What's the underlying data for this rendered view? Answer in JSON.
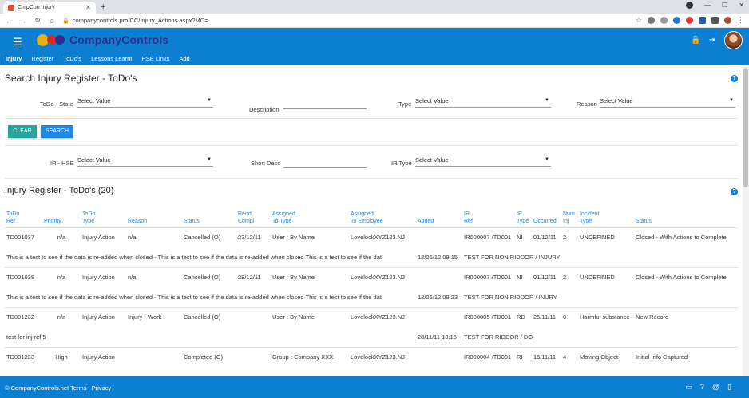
{
  "browser": {
    "tab_title": "CmpCon Injury",
    "url": "companycontrols.pro/CC/Injury_Actions.aspx?MC="
  },
  "app": {
    "brand": "CompanyControls",
    "nav": [
      "Injury",
      "Register",
      "ToDo's",
      "Lessons Learnt",
      "HSE Links",
      "Add"
    ]
  },
  "search": {
    "title": "Search  Injury Register - ToDo's",
    "todo_state_label": "ToDo - State",
    "todo_state_value": "Select Value",
    "description_label": "Description",
    "type_label": "Type",
    "type_value": "Select Value",
    "reason_label": "Reason",
    "reason_value": "Select Value",
    "clear_label": "CLEAR",
    "search_label": "SEARCH",
    "ir_hse_label": "IR - HSE",
    "ir_hse_value": "Select Value",
    "short_desc_label": "Short Desc",
    "ir_type_label": "IR Type",
    "ir_type_value": "Select Value"
  },
  "register": {
    "title": "Injury Register - ToDo's (20)",
    "headers": {
      "todo_ref": [
        "ToDo",
        "Ref"
      ],
      "priority": [
        "",
        "Priority"
      ],
      "todo_type": [
        "ToDo",
        "Type"
      ],
      "reason": [
        "",
        "Reason"
      ],
      "status": [
        "",
        "Status"
      ],
      "reqd_compl": [
        "Reqd",
        "Compl"
      ],
      "assigned_type": [
        "Assigned",
        "To Type"
      ],
      "assigned_emp": [
        "Assigned",
        "To Employee"
      ],
      "added": [
        "",
        "Added"
      ],
      "ir_ref": [
        "IR",
        "Ref"
      ],
      "ir_type": [
        "IR",
        "Type"
      ],
      "occurred": [
        "",
        "Occurred"
      ],
      "num_inj": [
        "Num",
        "Inj"
      ],
      "incident_type": [
        "Incident",
        "Type"
      ],
      "ir_status": [
        "",
        "Status"
      ]
    },
    "rows": [
      {
        "ref": "TD001037",
        "priority": "n/a",
        "type": "Injury Action",
        "reason": "n/a",
        "status": "Cancelled (O)",
        "reqd": "23/12/11",
        "assign_type": "User : By Name",
        "assign_emp": "LovelockXYZ123.NJ",
        "ir_ref": "IR000007 /TD001",
        "ir_type": "NI",
        "occurred": "01/12/11",
        "num_inj": "2",
        "incident": "UNDEFINED",
        "ir_status": "Closed - With Actions to Complete",
        "desc": "This is a test to see if the data is re-added when closed - This is a test to see if the data is re-added when closed This is a test to see if the dat",
        "added": "12/06/12 09:15",
        "short_desc": "TEST FOR NON RIDDOR / INJURY"
      },
      {
        "ref": "TD001038",
        "priority": "n/a",
        "type": "Injury Action",
        "reason": "n/a",
        "status": "Cancelled (O)",
        "reqd": "28/12/11",
        "assign_type": "User : By Name",
        "assign_emp": "LovelockXYZ123.NJ",
        "ir_ref": "IR000007 /TD001",
        "ir_type": "NI",
        "occurred": "01/12/11",
        "num_inj": "2",
        "incident": "UNDEFINED",
        "ir_status": "Closed - With Actions to Complete",
        "desc": "This is a test to see if the data is re-added when closed - This is a test to see if the data is re-added when closed This is a test to see if the dat",
        "added": "12/06/12 09:23",
        "short_desc": "TEST FOR NON RIDDOR / INURY"
      },
      {
        "ref": "TD001232",
        "priority": "n/a",
        "type": "Injury Action",
        "reason": "Injury - Work",
        "status": "Cancelled (O)",
        "reqd": "",
        "assign_type": "User : By Name",
        "assign_emp": "LovelockXYZ123.NJ",
        "ir_ref": "IR000005 /TD001",
        "ir_type": "RD",
        "occurred": "25/11/11",
        "num_inj": "0",
        "incident": "Harmful substance",
        "ir_status": "New Record",
        "desc": "test for inj ref 5",
        "added": "28/11/11 18:15",
        "short_desc": "TEST FOR RIDDOR / DO"
      },
      {
        "ref": "TD001233",
        "priority": "High",
        "type": "Injury Action",
        "reason": "",
        "status": "Completed (O)",
        "reqd": "",
        "assign_type": "Group : Company XXX",
        "assign_emp": "LovelockXYZ123.NJ",
        "ir_ref": "IR000004 /TD001",
        "ir_type": "RI",
        "occurred": "15/11/11",
        "num_inj": "4",
        "incident": "Moving Object",
        "ir_status": "Initial Info Captured",
        "desc": "",
        "added": "",
        "short_desc": ""
      }
    ]
  },
  "footer": {
    "text": "© CompanyControls.net Terms | Privacy"
  }
}
